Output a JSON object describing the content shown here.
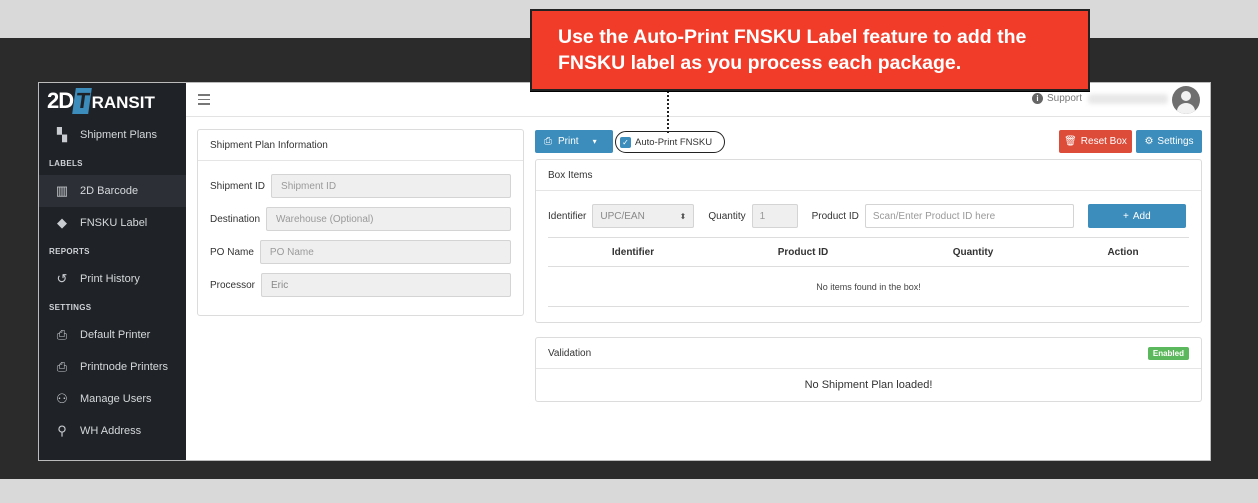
{
  "callout": {
    "line1": "Use the Auto-Print FNSKU Label feature to add the",
    "line2": "FNSKU label as you process each package."
  },
  "sidebar": {
    "logo_main": "2D",
    "logo_t": "T",
    "logo_rest": "RANSIT",
    "items": [
      {
        "type": "item",
        "label": "Shipment Plans",
        "icon": "shipment-plans-icon",
        "glyph": "▚"
      },
      {
        "type": "header",
        "label": "LABELS"
      },
      {
        "type": "item",
        "label": "2D Barcode",
        "icon": "barcode-icon",
        "glyph": "▥"
      },
      {
        "type": "item",
        "label": "FNSKU Label",
        "icon": "tag-icon",
        "glyph": "◆"
      },
      {
        "type": "header",
        "label": "REPORTS"
      },
      {
        "type": "item",
        "label": "Print History",
        "icon": "history-icon",
        "glyph": "↺"
      },
      {
        "type": "header",
        "label": "SETTINGS"
      },
      {
        "type": "item",
        "label": "Default Printer",
        "icon": "printer-icon",
        "glyph": "⎙"
      },
      {
        "type": "item",
        "label": "Printnode Printers",
        "icon": "printer-icon",
        "glyph": "⎙"
      },
      {
        "type": "item",
        "label": "Manage Users",
        "icon": "users-icon",
        "glyph": "⚇"
      },
      {
        "type": "item",
        "label": "WH Address",
        "icon": "map-marker-icon",
        "glyph": "⚲"
      }
    ]
  },
  "topbar": {
    "support_label": "Support"
  },
  "plan": {
    "title": "Shipment Plan Information",
    "shipment_id_label": "Shipment ID",
    "shipment_id_placeholder": "Shipment ID",
    "destination_label": "Destination",
    "destination_placeholder": "Warehouse (Optional)",
    "po_label": "PO Name",
    "po_placeholder": "PO Name",
    "processor_label": "Processor",
    "processor_value": "Eric"
  },
  "actions": {
    "print_label": "Print",
    "autoprint_label": "Auto-Print FNSKU",
    "autoprint_checked": true,
    "reset_label": "Reset Box",
    "settings_label": "Settings"
  },
  "box": {
    "title": "Box Items",
    "identifier_label": "Identifier",
    "identifier_value": "UPC/EAN",
    "quantity_label": "Quantity",
    "quantity_value": "1",
    "product_id_label": "Product ID",
    "product_id_placeholder": "Scan/Enter Product ID here",
    "add_label": "Add",
    "columns": [
      "Identifier",
      "Product ID",
      "Quantity",
      "Action"
    ],
    "empty_message": "No items found in the box!"
  },
  "validation": {
    "title": "Validation",
    "badge": "Enabled",
    "message": "No Shipment Plan loaded!"
  },
  "colors": {
    "primary": "#3c8dbc",
    "danger": "#dd4b39",
    "success": "#5cb85c",
    "sidebar_bg": "#1f2226",
    "callout_bg": "#f23c2a"
  }
}
